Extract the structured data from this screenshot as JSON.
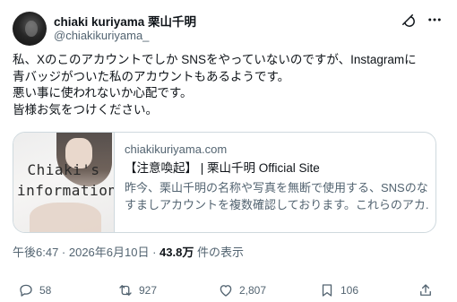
{
  "author": {
    "display_name": "chiaki kuriyama 栗山千明",
    "handle": "@chiakikuriyama_"
  },
  "tweet": {
    "lines": [
      "私、Xのこのアカウントでしか SNSをやっていないのですが、Instagramに",
      "青バッジがついた私のアカウントもあるようです。",
      "悪い事に使われないか心配です。",
      "皆様お気をつけください。"
    ]
  },
  "link_card": {
    "thumbnail_text_line1": "Chiaki's",
    "thumbnail_text_line2": "information",
    "domain": "chiakikuriyama.com",
    "title": "【注意喚起】 | 栗山千明 Official Site",
    "description_line1": "昨今、栗山千明の名称や写真を無断で使用する、SNSのなり",
    "description_line2": "すましアカウントを複数確認しております。これらのアカ..."
  },
  "meta": {
    "time_date": "午後6:47 · 2026年6月10日 · ",
    "views_count": "43.8万",
    "views_label": " 件の表示"
  },
  "actions": {
    "replies": "58",
    "reposts": "927",
    "likes": "2,807",
    "bookmarks": "106"
  },
  "icons": {
    "grok": "grok-icon",
    "more": "more-icon",
    "reply": "reply-icon",
    "repost": "repost-icon",
    "like": "heart-icon",
    "bookmark": "bookmark-icon",
    "share": "share-icon"
  },
  "colors": {
    "text": "#0f1419",
    "secondary": "#536471",
    "border": "#cfd9de"
  }
}
